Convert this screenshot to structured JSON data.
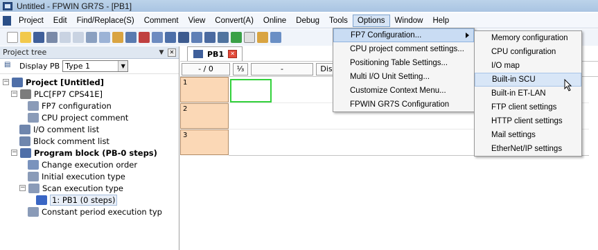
{
  "window": {
    "title": "Untitled - FPWIN GR7S - [PB1]"
  },
  "menubar": {
    "items": [
      "Project",
      "Edit",
      "Find/Replace(S)",
      "Comment",
      "View",
      "Convert(A)",
      "Online",
      "Debug",
      "Tools",
      "Options",
      "Window",
      "Help"
    ]
  },
  "left_pane": {
    "header": "Project tree",
    "display_label": "Display PB",
    "type_value": "Type 1",
    "tree": [
      {
        "label": "Project [Untitled]",
        "bold": true
      },
      {
        "label": "PLC[FP7 CPS41E]"
      },
      {
        "label": "FP7 configuration"
      },
      {
        "label": "CPU project comment"
      },
      {
        "label": "I/O comment list"
      },
      {
        "label": "Block comment list"
      },
      {
        "label": "Program block (PB-0 steps)",
        "bold": true
      },
      {
        "label": "Change execution order"
      },
      {
        "label": "Initial execution type"
      },
      {
        "label": "Scan execution type"
      },
      {
        "label": "1: PB1 (0 steps)"
      },
      {
        "label": "Constant period execution typ"
      }
    ]
  },
  "editor": {
    "tab_label": "PB1",
    "ruler": {
      "pos": "- /",
      "step": "0",
      "dash": "-",
      "dis": "Dis"
    },
    "rows": [
      "1",
      "2",
      "3"
    ]
  },
  "options_menu": {
    "items": [
      "FP7 Configuration...",
      "CPU project comment settings...",
      "Positioning Table Settings...",
      "Multi I/O Unit Setting...",
      "Customize Context Menu...",
      "FPWIN GR7S Configuration"
    ]
  },
  "fp7_submenu": {
    "items": [
      "Memory configuration",
      "CPU configuration",
      "I/O map",
      "Built-in SCU",
      "Built-in ET-LAN",
      "FTP client settings",
      "HTTP client settings",
      "Mail settings",
      "EtherNet/IP settings"
    ]
  }
}
